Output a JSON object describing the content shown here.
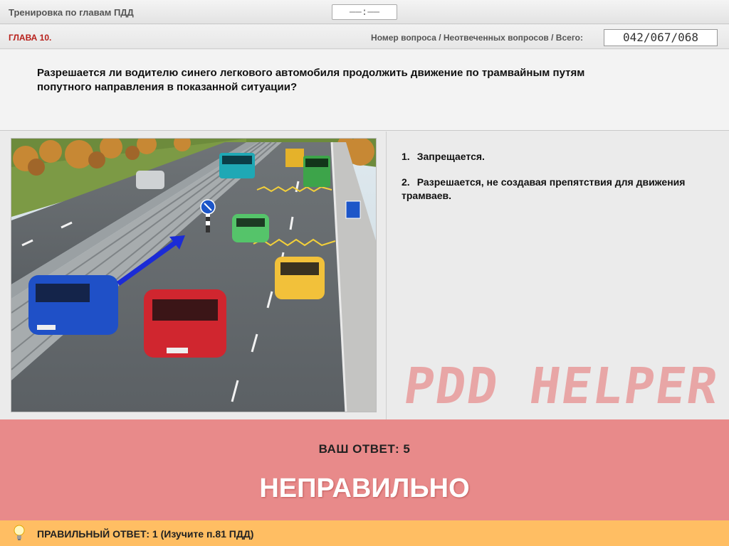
{
  "header": {
    "title": "Тренировка по главам ПДД",
    "timer": "——:——"
  },
  "info": {
    "chapter": "ГЛАВА 10.",
    "counter_label": "Номер вопроса / Неотвеченных вопросов / Всего:",
    "counter_value": "042/067/068"
  },
  "question": {
    "text": "Разрешается ли водителю синего легкового автомобиля продолжить движение по трамвайным путям попутного направления в показанной ситуации?"
  },
  "answers": [
    {
      "num": "1.",
      "text": "Запрещается."
    },
    {
      "num": "2.",
      "text": "Разрешается, не создавая препятствия для движения трамваев."
    }
  ],
  "watermark": "PDD HELPER",
  "result": {
    "your_answer": "ВАШ  ОТВЕТ:   5",
    "verdict": "НЕПРАВИЛЬНО",
    "color": "#e88a8a"
  },
  "footer": {
    "correct": "ПРАВИЛЬНЫЙ ОТВЕТ:   1   (Изучите п.81 ПДД)",
    "icon": "lightbulb-icon",
    "color": "#ffbe63"
  }
}
